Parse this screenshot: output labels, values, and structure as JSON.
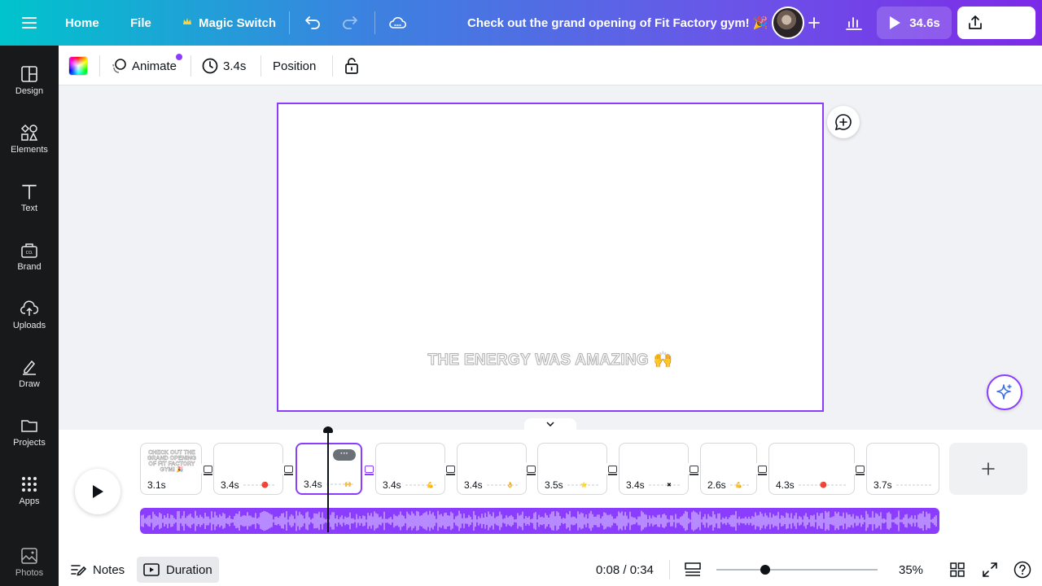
{
  "topbar": {
    "home": "Home",
    "file": "File",
    "magic_switch": "Magic Switch",
    "doc_title": "Check out the grand opening of Fit Factory gym! 🎉",
    "play_duration": "34.6s",
    "share": "Share"
  },
  "sidebar": {
    "items": [
      {
        "label": "Design",
        "icon": "design-icon"
      },
      {
        "label": "Elements",
        "icon": "elements-icon"
      },
      {
        "label": "Text",
        "icon": "text-icon"
      },
      {
        "label": "Brand",
        "icon": "brand-icon"
      },
      {
        "label": "Uploads",
        "icon": "uploads-icon"
      },
      {
        "label": "Draw",
        "icon": "draw-icon"
      },
      {
        "label": "Projects",
        "icon": "projects-icon"
      },
      {
        "label": "Apps",
        "icon": "apps-icon"
      },
      {
        "label": "Photos",
        "icon": "photos-icon"
      }
    ]
  },
  "toolbar": {
    "animate": "Animate",
    "timing": "3.4s",
    "position": "Position"
  },
  "canvas": {
    "caption": "THE ENERGY WAS AMAZING 🙌",
    "accent_color": "#8b3dff"
  },
  "timeline": {
    "scenes": [
      {
        "duration": "3.1s",
        "emoji": "🎉",
        "thumb_text": "CHECK OUT THE GRAND OPENING OF FIT FACTORY GYM! 🎉"
      },
      {
        "duration": "3.4s",
        "emoji": "🔴"
      },
      {
        "duration": "3.4s",
        "emoji": "🙌"
      },
      {
        "duration": "3.4s",
        "emoji": "💪"
      },
      {
        "duration": "3.4s",
        "emoji": "👌"
      },
      {
        "duration": "3.5s",
        "emoji": "⭐"
      },
      {
        "duration": "3.4s",
        "emoji": "✖"
      },
      {
        "duration": "2.6s",
        "emoji": "💪"
      },
      {
        "duration": "4.3s",
        "emoji": "🔴"
      },
      {
        "duration": "3.7s",
        "emoji": ""
      }
    ],
    "selected_index": 2,
    "more_label": "···",
    "add_label": "+"
  },
  "bottombar": {
    "notes": "Notes",
    "duration": "Duration",
    "time": "0:08 / 0:34",
    "zoom": "35%",
    "zoom_fraction": 0.35
  }
}
